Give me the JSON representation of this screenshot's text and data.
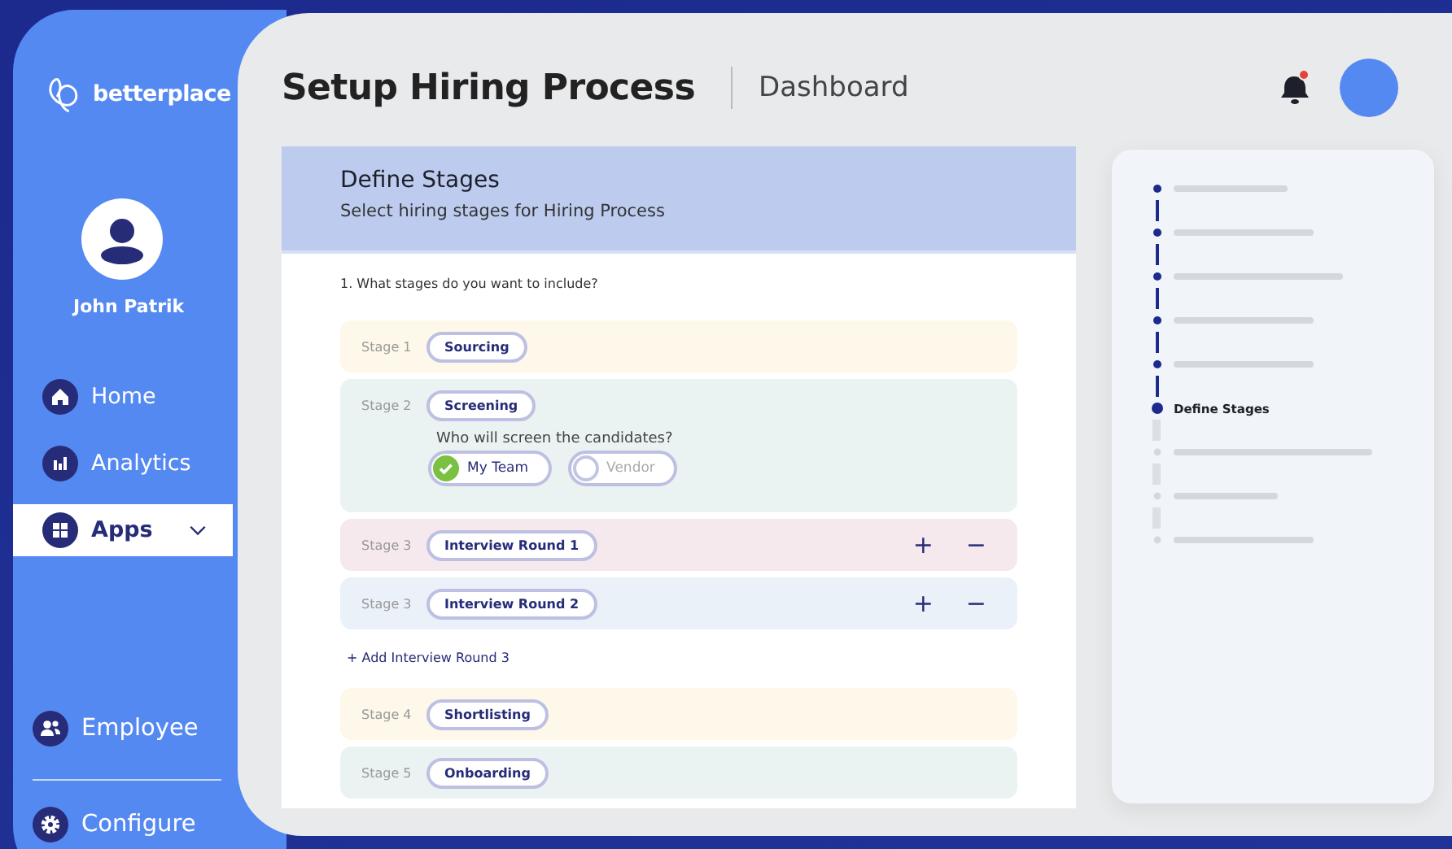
{
  "sidebar": {
    "brand": "betterplace",
    "user": {
      "name": "John Patrik"
    },
    "nav": [
      {
        "label": "Home",
        "selected": false
      },
      {
        "label": "Analytics",
        "selected": false
      },
      {
        "label": "Apps",
        "selected": true,
        "expanded": false
      }
    ],
    "bottom_nav": [
      {
        "label": "Employee",
        "selected": false
      },
      {
        "label": "Configure",
        "selected": false
      }
    ]
  },
  "header": {
    "title": "Setup Hiring Process",
    "breadcrumb": "Dashboard",
    "notifications_unread": true
  },
  "card": {
    "title": "Define Stages",
    "subtitle": "Select hiring stages for Hiring  Process",
    "question": "1. What stages do you want to include?",
    "stages": [
      {
        "kind": "basic",
        "label": "Stage 1",
        "name": "Sourcing",
        "color": "#fdf8ea"
      },
      {
        "kind": "screening",
        "label": "Stage 2",
        "name": "Screening",
        "color": "#ebf3f2",
        "question": "Who will screen the candidates?",
        "options": [
          {
            "label": "My Team",
            "selected": true
          },
          {
            "label": "Vendor",
            "selected": false
          }
        ]
      },
      {
        "kind": "interview",
        "label": "Stage 3",
        "name": "Interview Round 1",
        "color": "#f5e9ee",
        "add": "+",
        "remove": "−"
      },
      {
        "kind": "interview",
        "label": "Stage 3",
        "name": "Interview Round 2",
        "color": "#eaf1f9",
        "add": "+",
        "remove": "−"
      },
      {
        "kind": "add_link",
        "label": "+ Add Interview Round 3"
      },
      {
        "kind": "basic",
        "label": "Stage 4",
        "name": "Shortlisting",
        "color": "#fdf8ea"
      },
      {
        "kind": "basic",
        "label": "Stage 5",
        "name": "Onboarding",
        "color": "#ebf3f2"
      }
    ]
  },
  "stepper": {
    "steps": [
      {
        "completed": true,
        "selected": false
      },
      {
        "completed": true,
        "selected": false
      },
      {
        "completed": true,
        "selected": false
      },
      {
        "completed": true,
        "selected": false
      },
      {
        "completed": true,
        "selected": false
      },
      {
        "completed": true,
        "selected": true,
        "label": "Define Stages"
      },
      {
        "completed": false,
        "selected": false
      },
      {
        "completed": false,
        "selected": false
      },
      {
        "completed": false,
        "selected": false
      }
    ]
  }
}
